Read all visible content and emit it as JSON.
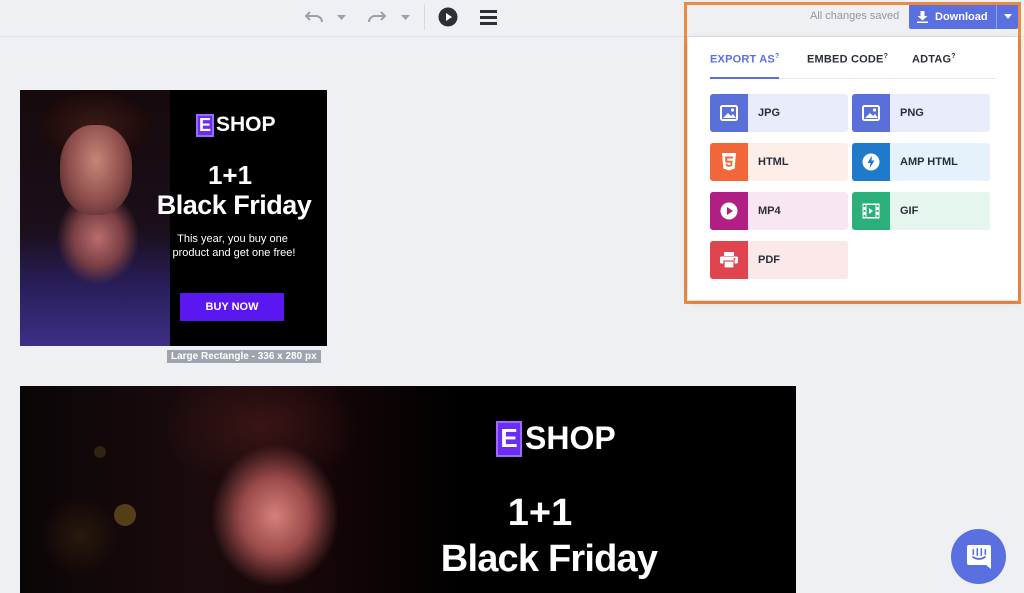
{
  "toolbar": {
    "status": "All changes saved",
    "download_label": "Download"
  },
  "export_popup": {
    "tabs": [
      {
        "label": "EXPORT AS",
        "sup": "?"
      },
      {
        "label": "EMBED CODE",
        "sup": "?"
      },
      {
        "label": "ADTAG",
        "sup": "?"
      }
    ],
    "options": [
      {
        "label": "JPG",
        "color": "#5a6fd8",
        "bg": "#e9ecfb"
      },
      {
        "label": "PNG",
        "color": "#5a6fd8",
        "bg": "#e9ecfb"
      },
      {
        "label": "HTML",
        "color": "#f0683a",
        "bg": "#fdeee8"
      },
      {
        "label": "AMP HTML",
        "color": "#1f7ac9",
        "bg": "#e5f1fb"
      },
      {
        "label": "MP4",
        "color": "#b01f84",
        "bg": "#f8e6f2"
      },
      {
        "label": "GIF",
        "color": "#2bb07c",
        "bg": "#e5f6ef"
      },
      {
        "label": "PDF",
        "color": "#e0454f",
        "bg": "#fbe8e9"
      }
    ]
  },
  "banner_small": {
    "logo_letter": "E",
    "logo_text": "SHOP",
    "headline_1": "1+1",
    "headline_2": "Black Friday",
    "subtext_1": "This year, you buy one",
    "subtext_2": "product and get one free!",
    "cta": "BUY NOW",
    "size_label": "Large Rectangle - 336 x 280 px"
  },
  "banner_large": {
    "logo_letter": "E",
    "logo_text": "SHOP",
    "headline_1": "1+1",
    "headline_2": "Black Friday"
  },
  "colors": {
    "accent": "#5a6fe0",
    "highlight": "#ee8a3d",
    "brand_purple": "#6c2df2"
  }
}
